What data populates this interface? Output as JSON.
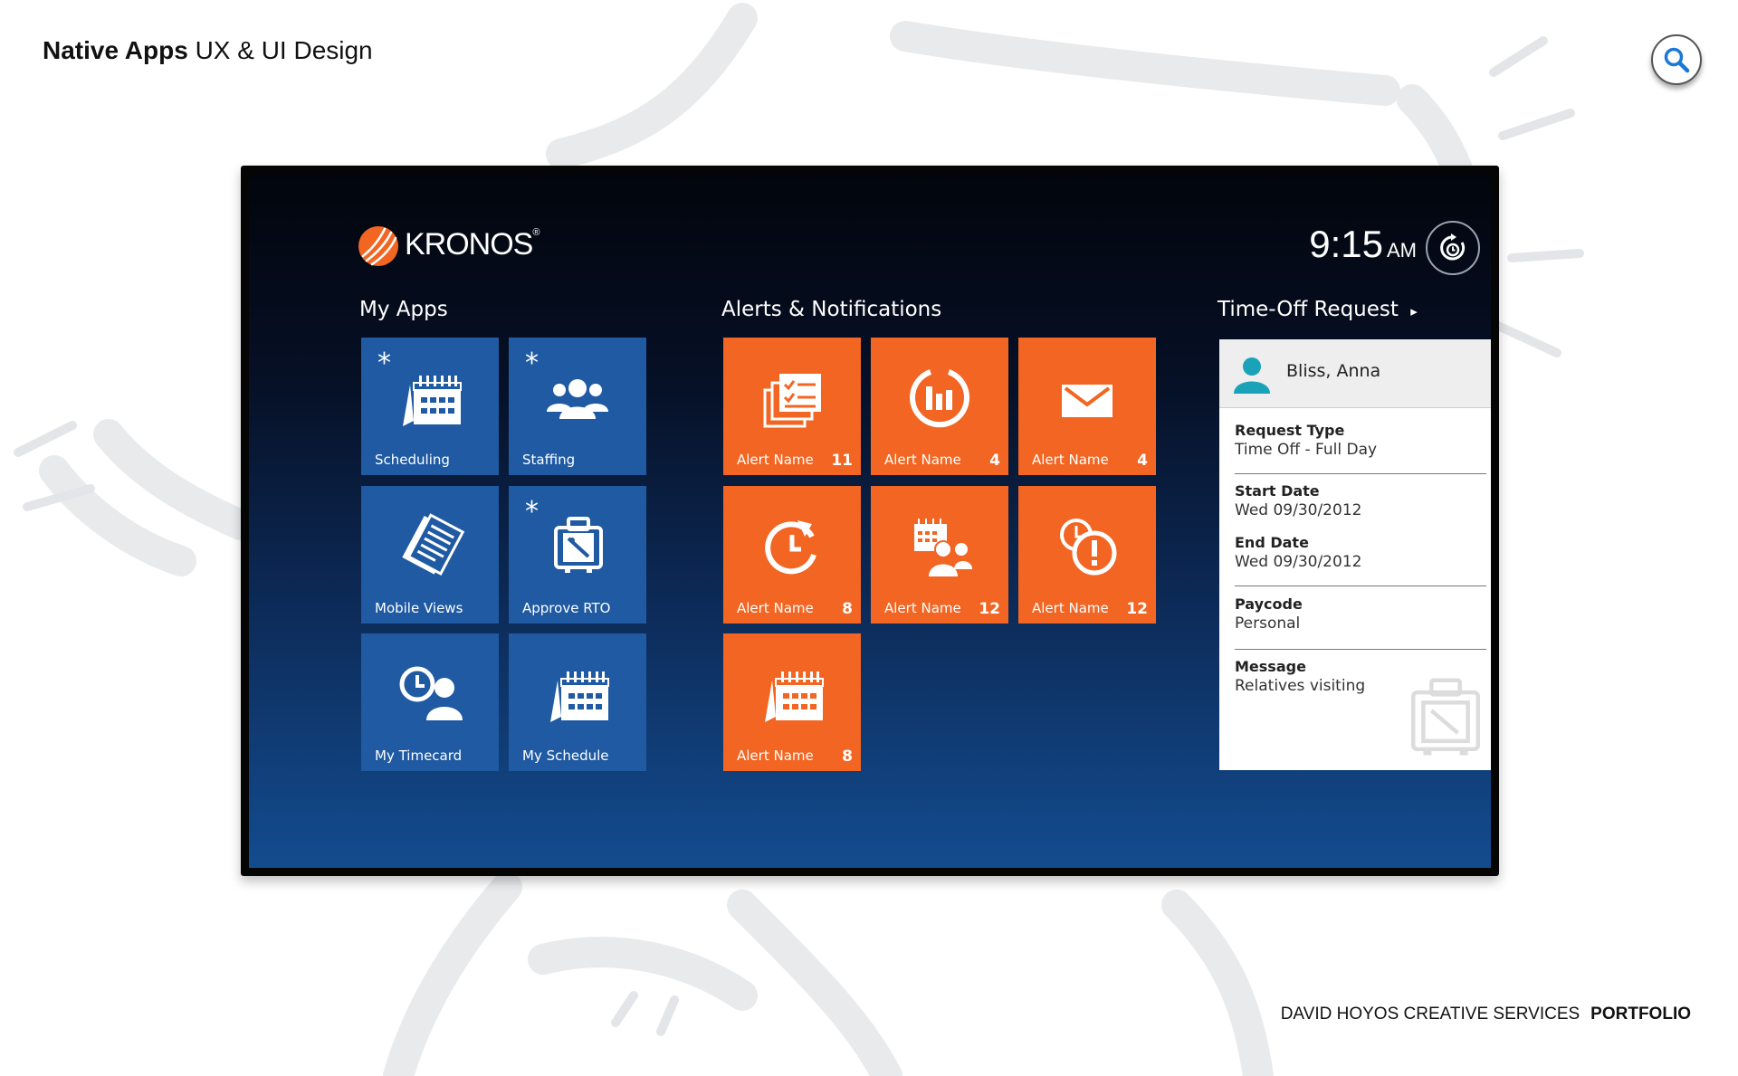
{
  "page": {
    "title_bold": "Native Apps",
    "title_rest": "UX & UI Design",
    "search_icon": "search-icon",
    "footer_studio": "DAVID HOYOS CREATIVE SERVICES",
    "footer_section": "PORTFOLIO"
  },
  "app": {
    "logo_text": "KRONOS",
    "logo_mark": "®",
    "time": "9:15",
    "ampm": "AM",
    "sync_icon": "clock-refresh-icon"
  },
  "my_apps": {
    "heading": "My Apps",
    "tiles": [
      {
        "label": "Scheduling",
        "icon": "calendar-icon",
        "starred": "*"
      },
      {
        "label": "Staffing",
        "icon": "people-icon",
        "starred": "*"
      },
      {
        "label": "Mobile Views",
        "icon": "documents-icon",
        "starred": ""
      },
      {
        "label": "Approve RTO",
        "icon": "luggage-icon",
        "starred": "*"
      },
      {
        "label": "My Timecard",
        "icon": "clock-person-icon",
        "starred": ""
      },
      {
        "label": "My Schedule",
        "icon": "calendar-icon",
        "starred": ""
      }
    ]
  },
  "alerts": {
    "heading": "Alerts & Notifications",
    "tiles": [
      {
        "label": "Alert Name",
        "count": "11",
        "icon": "checklist-icon"
      },
      {
        "label": "Alert Name",
        "count": "4",
        "icon": "chart-icon"
      },
      {
        "label": "Alert Name",
        "count": "4",
        "icon": "envelope-icon"
      },
      {
        "label": "Alert Name",
        "count": "8",
        "icon": "clock-refresh-icon"
      },
      {
        "label": "Alert Name",
        "count": "12",
        "icon": "calendar-people-icon"
      },
      {
        "label": "Alert Name",
        "count": "12",
        "icon": "clock-alert-icon"
      },
      {
        "label": "Alert Name",
        "count": "8",
        "icon": "calendar-icon"
      }
    ]
  },
  "time_off": {
    "heading": "Time-Off Request",
    "arrow": "▸",
    "employee": "Bliss, Anna",
    "request_type_label": "Request Type",
    "request_type_value": "Time Off - Full Day",
    "start_date_label": "Start Date",
    "start_date_value": "Wed 09/30/2012",
    "end_date_label": "End Date",
    "end_date_value": "Wed 09/30/2012",
    "paycode_label": "Paycode",
    "paycode_value": "Personal",
    "message_label": "Message",
    "message_value": "Relatives visiting"
  },
  "colors": {
    "tile_blue": "#1f5aa3",
    "tile_orange": "#f26522",
    "logo_orange": "#f26522",
    "avatar_teal": "#1aa3b8"
  }
}
